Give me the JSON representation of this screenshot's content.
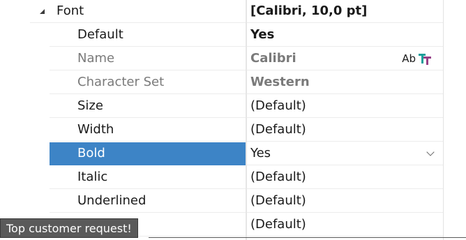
{
  "category": {
    "name": "Font",
    "value": "[Calibri, 10,0 pt]"
  },
  "rows": [
    {
      "name": "Default",
      "value": "Yes"
    },
    {
      "name": "Name",
      "value": "Calibri",
      "editor_text": "Ab"
    },
    {
      "name": "Character Set",
      "value": "Western"
    },
    {
      "name": "Size",
      "value": "(Default)"
    },
    {
      "name": "Width",
      "value": "(Default)"
    },
    {
      "name": "Bold",
      "value": "Yes"
    },
    {
      "name": "Italic",
      "value": "(Default)"
    },
    {
      "name": "Underlined",
      "value": "(Default)"
    },
    {
      "name": "",
      "value": "(Default)"
    }
  ],
  "tooltip": "Top customer request!",
  "colors": {
    "selection": "#3d84c6",
    "tooltip_bg": "#5a5a5a"
  },
  "icons": {
    "expander": "collapse-triangle-icon",
    "font_picker": "font-picker-icon",
    "dropdown": "chevron-down-icon"
  }
}
